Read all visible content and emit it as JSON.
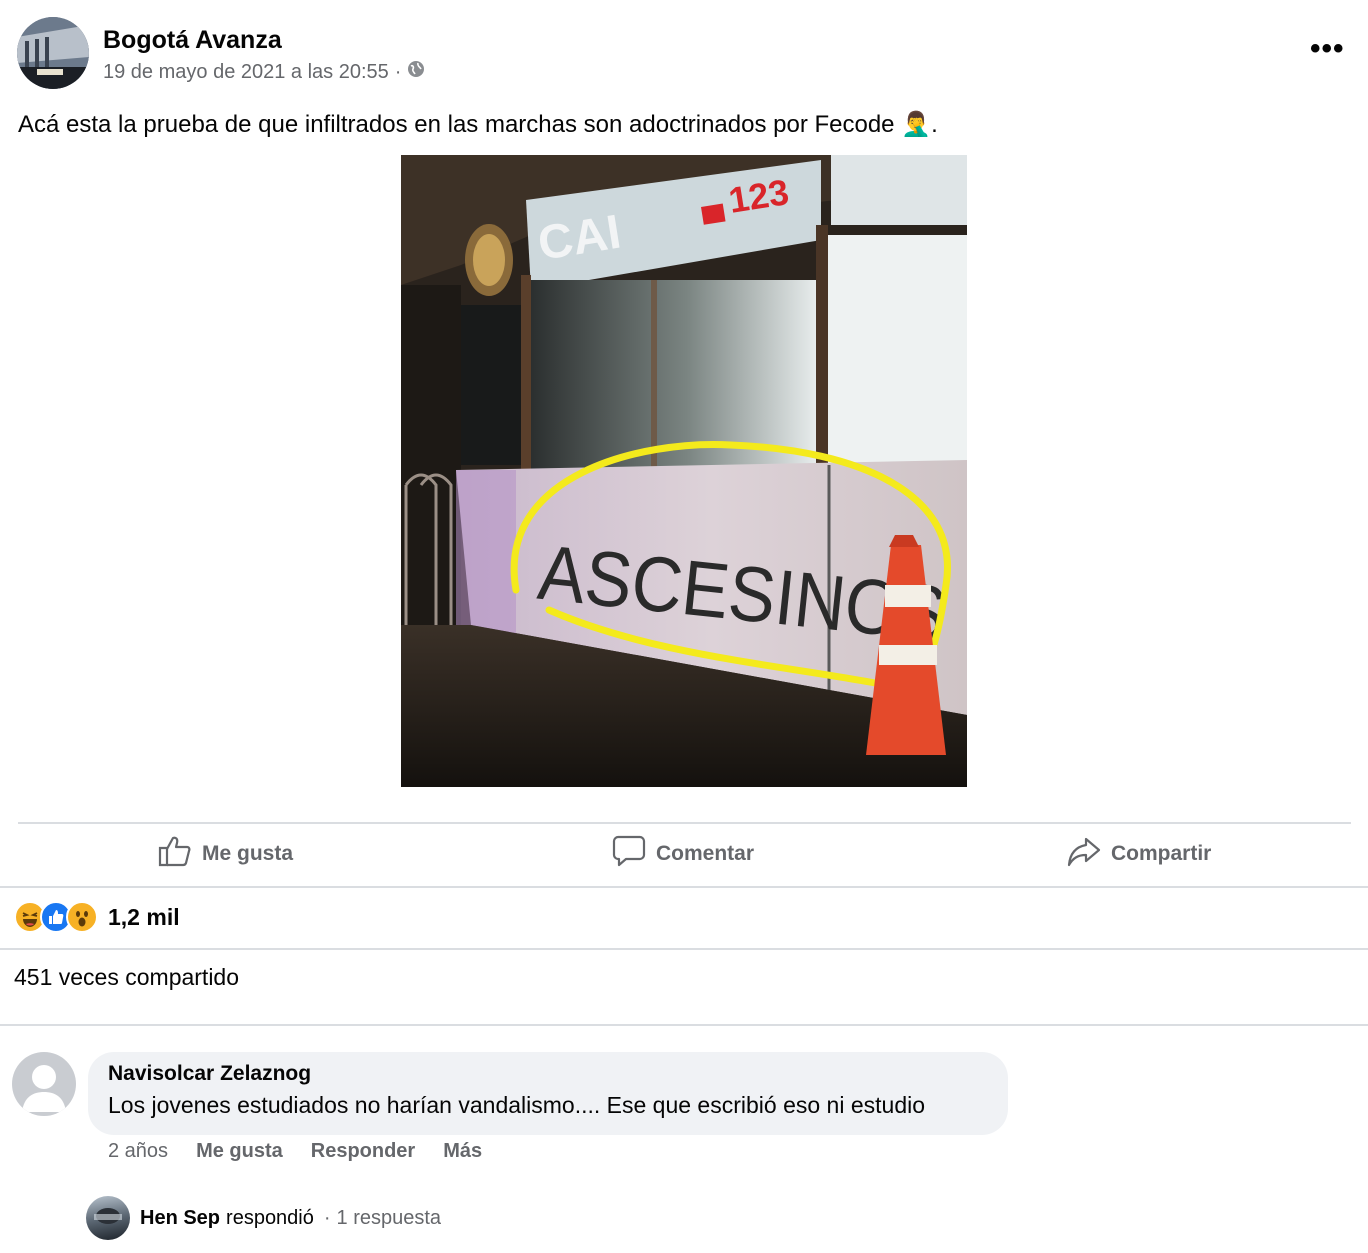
{
  "post": {
    "page_name": "Bogotá Avanza",
    "timestamp": "19 de mayo de 2021 a las 20:55",
    "separator": "·",
    "privacy_icon": "globe-icon",
    "more_label": "•••",
    "text": "Acá esta la prueba de que infiltrados en las marchas son adoctrinados por Fecode",
    "emoji": "🤦‍♂️",
    "text_end": "."
  },
  "photo": {
    "sign_text": "CAI",
    "phone_text": "123",
    "graffiti_text": "ASCESINOS",
    "highlight_color": "#f4ea1c"
  },
  "actions": {
    "like": "Me gusta",
    "comment": "Comentar",
    "share": "Compartir"
  },
  "reactions": {
    "icons": [
      "haha-icon",
      "like-icon",
      "wow-icon"
    ],
    "count": "1,2 mil"
  },
  "shares": "451 veces compartido",
  "comment": {
    "author": "Navisolcar Zelaznog",
    "text": "Los jovenes estudiados no harían vandalismo.... Ese que escribió eso ni estudio",
    "age": "2 años",
    "like": "Me gusta",
    "reply": "Responder",
    "more": "Más"
  },
  "reply_summary": {
    "author": "Hen Sep",
    "verb": "respondió",
    "separator": "·",
    "count": "1 respuesta"
  },
  "colors": {
    "secondary_text": "#65676b",
    "divider": "#dadde1",
    "bubble": "#f0f2f5",
    "like_blue": "#1877f2",
    "reaction_yellow": "#f7b125"
  }
}
